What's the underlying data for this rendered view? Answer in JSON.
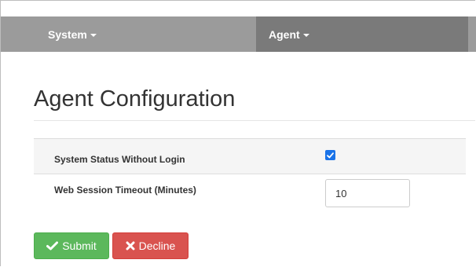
{
  "navbar": {
    "items": [
      {
        "label": "System"
      },
      {
        "label": "Agent"
      }
    ]
  },
  "page": {
    "title": "Agent Configuration"
  },
  "config": {
    "rows": [
      {
        "label": "System Status Without Login",
        "checked": true
      },
      {
        "label": "Web Session Timeout (Minutes)",
        "value": "10"
      }
    ]
  },
  "actions": {
    "submit_label": "Submit",
    "decline_label": "Decline"
  },
  "colors": {
    "navbar": "#9b9b9b",
    "navbar_active": "#7a7a7a",
    "submit": "#5cb85c",
    "decline": "#d9534f",
    "checkbox": "#1a73e8"
  },
  "icons": {
    "submit": "check-icon",
    "decline": "x-icon",
    "menu": "caret-down-icon"
  }
}
